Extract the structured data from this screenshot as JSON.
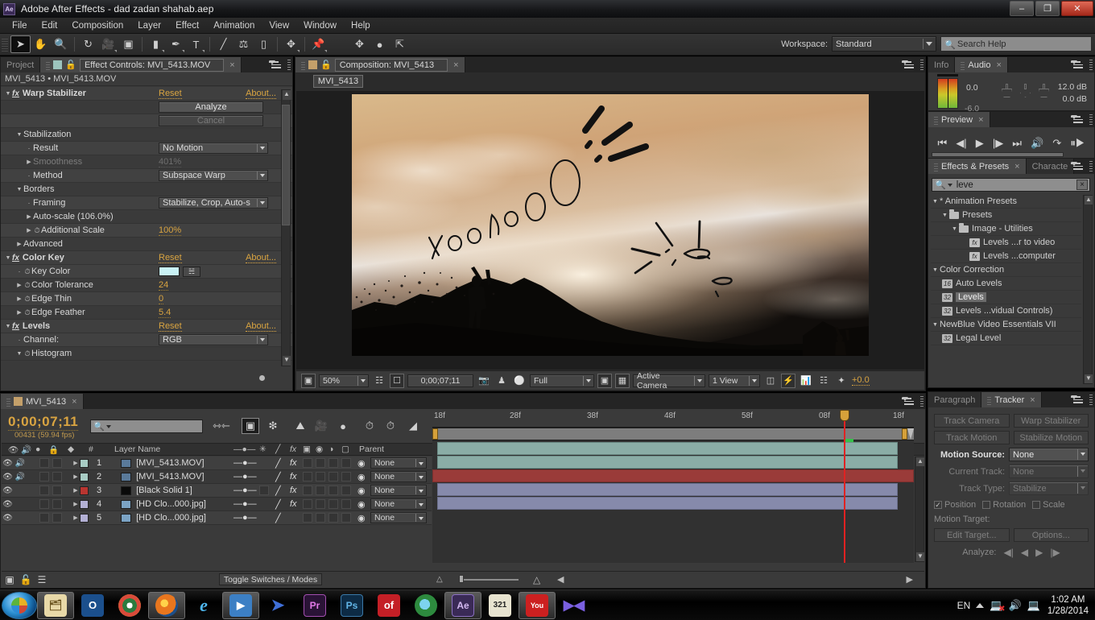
{
  "window": {
    "app_icon": "ae-icon",
    "title": "Adobe After Effects - dad zadan shahab.aep",
    "minimize": "–",
    "restore": "❐",
    "close": "✕"
  },
  "menubar": [
    "File",
    "Edit",
    "Composition",
    "Layer",
    "Effect",
    "Animation",
    "View",
    "Window",
    "Help"
  ],
  "toolbar": {
    "tools": [
      "selection-tool",
      "hand-tool",
      "zoom-tool",
      "rotation-tool",
      "camera-tool",
      "pan-behind-tool",
      "shape-tool",
      "pen-tool",
      "type-tool",
      "brush-tool",
      "clone-stamp-tool",
      "eraser-tool",
      "roto-brush-tool",
      "puppet-pin-tool"
    ],
    "workspace_label": "Workspace:",
    "workspace_value": "Standard",
    "search_help_placeholder": "Search Help"
  },
  "effect_controls": {
    "tab_inactive": "Project",
    "tab_active": "Effect Controls: MVI_5413.MOV",
    "subtitle": "MVI_5413 • MVI_5413.MOV",
    "rows": [
      {
        "kind": "effect",
        "name": "Warp Stabilizer",
        "reset": "Reset",
        "about": "About..."
      },
      {
        "kind": "button",
        "label": "Analyze",
        "disabled": false
      },
      {
        "kind": "button",
        "label": "Cancel",
        "disabled": true
      },
      {
        "kind": "group",
        "name": "Stabilization"
      },
      {
        "kind": "dropdown",
        "name": "Result",
        "value": "No Motion"
      },
      {
        "kind": "value",
        "name": "Smoothness",
        "value": "401%",
        "dim": true
      },
      {
        "kind": "dropdown",
        "name": "Method",
        "value": "Subspace Warp"
      },
      {
        "kind": "group",
        "name": "Borders"
      },
      {
        "kind": "dropdown",
        "name": "Framing",
        "value": "Stabilize, Crop, Auto-s"
      },
      {
        "kind": "sub",
        "name": "Auto-scale (106.0%)"
      },
      {
        "kind": "value",
        "name": "Additional Scale",
        "value": "100%",
        "stopwatch": true
      },
      {
        "kind": "sub",
        "name": "Advanced"
      },
      {
        "kind": "effect",
        "name": "Color Key",
        "reset": "Reset",
        "about": "About..."
      },
      {
        "kind": "color",
        "name": "Key Color",
        "color": "#c9f2f5"
      },
      {
        "kind": "value",
        "name": "Color Tolerance",
        "value": "24",
        "stopwatch": true
      },
      {
        "kind": "value",
        "name": "Edge Thin",
        "value": "0",
        "stopwatch": true
      },
      {
        "kind": "value",
        "name": "Edge Feather",
        "value": "5.4",
        "stopwatch": true
      },
      {
        "kind": "effect",
        "name": "Levels",
        "reset": "Reset",
        "about": "About..."
      },
      {
        "kind": "dropdown",
        "name": "Channel:",
        "value": "RGB"
      },
      {
        "kind": "group",
        "name": "Histogram",
        "stopwatch": true
      }
    ]
  },
  "composition": {
    "tab_label": "Composition: MVI_5413",
    "comp_name_tab": "MVI_5413",
    "viewer_toolbar": {
      "magnification": "50%",
      "timecode": "0;00;07;11",
      "resolution": "Full",
      "view_layout": "Active Camera",
      "views": "1 View",
      "exposure": "+0.0"
    },
    "annotations": [
      "YoohoOO",
      "burst-lines",
      "starburst"
    ]
  },
  "info_audio": {
    "tab_info": "Info",
    "tab_audio": "Audio",
    "level_top": "0.0",
    "level_bottom": "-6.0",
    "db_top": "12.0 dB",
    "db_bottom": "0.0 dB"
  },
  "preview": {
    "tab": "Preview",
    "buttons": [
      "first-frame",
      "prev-frame",
      "play",
      "next-frame",
      "last-frame",
      "audio",
      "loop",
      "ram-preview"
    ]
  },
  "effects_presets": {
    "tab_active": "Effects & Presets",
    "tab_inactive": "Characte",
    "search_value": "leve",
    "tree": [
      {
        "depth": 0,
        "tri": "▼",
        "icon": "asterisk",
        "label": "* Animation Presets"
      },
      {
        "depth": 1,
        "tri": "▼",
        "icon": "folder",
        "label": "Presets"
      },
      {
        "depth": 2,
        "tri": "▼",
        "icon": "folder",
        "label": "Image - Utilities"
      },
      {
        "depth": 3,
        "tri": "",
        "icon": "preset",
        "label": "Levels ...r to video"
      },
      {
        "depth": 3,
        "tri": "",
        "icon": "preset",
        "label": "Levels ...computer"
      },
      {
        "depth": 0,
        "tri": "▼",
        "icon": "",
        "label": "Color Correction"
      },
      {
        "depth": 1,
        "tri": "",
        "icon": "effect16",
        "label": "Auto Levels"
      },
      {
        "depth": 1,
        "tri": "",
        "icon": "effect32",
        "label": "Levels",
        "selected": true
      },
      {
        "depth": 1,
        "tri": "",
        "icon": "effect32",
        "label": "Levels ...vidual Controls)"
      },
      {
        "depth": 0,
        "tri": "▼",
        "icon": "",
        "label": "NewBlue Video Essentials VII"
      },
      {
        "depth": 1,
        "tri": "",
        "icon": "effect32",
        "label": "Legal Level"
      }
    ]
  },
  "tracker": {
    "tab_inactive": "Paragraph",
    "tab_active": "Tracker",
    "track_camera": "Track Camera",
    "warp_stabilizer": "Warp Stabilizer",
    "track_motion": "Track Motion",
    "stabilize_motion": "Stabilize Motion",
    "motion_source_label": "Motion Source:",
    "motion_source_value": "None",
    "current_track_label": "Current Track:",
    "current_track_value": "None",
    "track_type_label": "Track Type:",
    "track_type_value": "Stabilize",
    "position": "Position",
    "rotation": "Rotation",
    "scale": "Scale",
    "motion_target_label": "Motion Target:",
    "edit_target": "Edit Target...",
    "options": "Options...",
    "analyze_label": "Analyze:"
  },
  "timeline": {
    "tab": "MVI_5413",
    "current_time": "0;00;07;11",
    "frame_info": "00431 (59.94 fps)",
    "columns": {
      "num": "#",
      "layer_name": "Layer Name",
      "parent": "Parent"
    },
    "ruler_ticks": [
      "18f",
      "28f",
      "38f",
      "48f",
      "58f",
      "08f",
      "18f"
    ],
    "layers": [
      {
        "num": "1",
        "name": "[MVI_5413.MOV]",
        "label_color": "#a8ccc4",
        "bar_color": "#8aada6",
        "audio": true,
        "fx": true,
        "thumb": "#5a7a9a"
      },
      {
        "num": "2",
        "name": "[MVI_5413.MOV]",
        "label_color": "#a8ccc4",
        "bar_color": "#8aada6",
        "audio": true,
        "fx": true,
        "thumb": "#5a7a9a"
      },
      {
        "num": "3",
        "name": "[Black Solid 1]",
        "label_color": "#b93530",
        "bar_color": "#9a3b39",
        "audio": false,
        "fx": true,
        "thumb": "#0a0a0a"
      },
      {
        "num": "4",
        "name": "[HD Clo...000.jpg]",
        "label_color": "#b3b0d4",
        "bar_color": "#868aab",
        "audio": false,
        "fx": true,
        "thumb": "#7ba3c4"
      },
      {
        "num": "5",
        "name": "[HD Clo...000.jpg]",
        "label_color": "#b3b0d4",
        "bar_color": "#868aab",
        "audio": false,
        "fx": false,
        "thumb": "#7ba3c4"
      }
    ],
    "toggle_switches": "Toggle Switches / Modes"
  },
  "taskbar": {
    "start": "start-orb",
    "items": [
      {
        "name": "windows-explorer",
        "glyph": "🗂",
        "bg": "#e8d9a8",
        "fg": "#6b5520",
        "active": false
      },
      {
        "name": "opera-browser",
        "glyph": "O",
        "bg": "#1b4f8c",
        "fg": "#ffffff",
        "active": false
      },
      {
        "name": "google-chrome",
        "glyph": "●",
        "bg": "#2b7b3e",
        "fg": "#ffffff",
        "active": false
      },
      {
        "name": "mozilla-firefox",
        "glyph": "◉",
        "bg": "#d96a1e",
        "fg": "#ffffff",
        "active": true
      },
      {
        "name": "internet-explorer",
        "glyph": "e",
        "bg": "#0a2b4d",
        "fg": "#4fb8ef",
        "active": false
      },
      {
        "name": "windows-media-player",
        "glyph": "▶",
        "bg": "#3c7fc4",
        "fg": "#ffffff",
        "active": true
      },
      {
        "name": "freemake-converter",
        "glyph": "➤",
        "bg": "#1f4f9e",
        "fg": "#ffffff",
        "active": false
      },
      {
        "name": "adobe-premiere",
        "glyph": "Pr",
        "bg": "#2a1336",
        "fg": "#e37ae8",
        "active": false
      },
      {
        "name": "adobe-photoshop",
        "glyph": "Ps",
        "bg": "#0d2b45",
        "fg": "#62b6e8",
        "active": false
      },
      {
        "name": "openoffice",
        "glyph": "of",
        "bg": "#c41f26",
        "fg": "#ffffff",
        "active": false
      },
      {
        "name": "flash-player",
        "glyph": "◐",
        "bg": "#2d8a3e",
        "fg": "#ffffff",
        "active": false
      },
      {
        "name": "after-effects",
        "glyph": "Ae",
        "bg": "#3a2a56",
        "fg": "#d3b8f0",
        "active": true
      },
      {
        "name": "k-lite-codec",
        "glyph": "321",
        "bg": "#e8e4d0",
        "fg": "#222222",
        "active": false
      },
      {
        "name": "youtube-downloader",
        "glyph": "You",
        "bg": "#cc2020",
        "fg": "#ffffff",
        "active": true
      },
      {
        "name": "media-player-x",
        "glyph": "▶◀",
        "bg": "#6a4fd0",
        "fg": "#ffffff",
        "active": false
      }
    ],
    "language": "EN",
    "time": "1:02 AM",
    "date": "1/28/2014"
  }
}
